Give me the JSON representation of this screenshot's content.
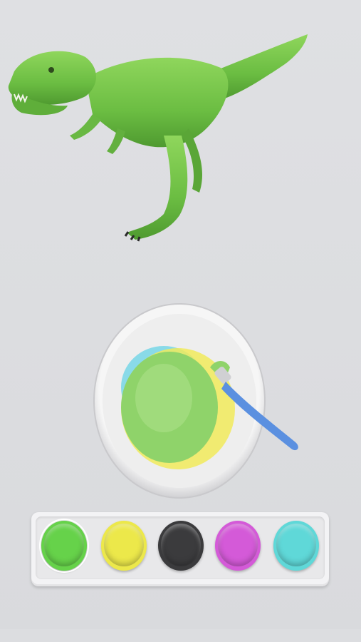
{
  "scene": {
    "background": "#dcdde0",
    "model": "tyrannosaurus",
    "model_color": "#7ac84a"
  },
  "plate": {
    "mixed_colors": [
      "#8fd36a",
      "#f1ea5a",
      "#6fd4e6"
    ]
  },
  "brush": {
    "tip_color": "#8fd36a",
    "handle_color": "#5b90e0"
  },
  "palette": {
    "selected_index": 0,
    "swatches": [
      {
        "name": "green",
        "color": "#66d24a"
      },
      {
        "name": "yellow",
        "color": "#ece84a"
      },
      {
        "name": "black",
        "color": "#3b3b3d"
      },
      {
        "name": "magenta",
        "color": "#d45ad8"
      },
      {
        "name": "cyan",
        "color": "#5fd8d8"
      }
    ]
  }
}
